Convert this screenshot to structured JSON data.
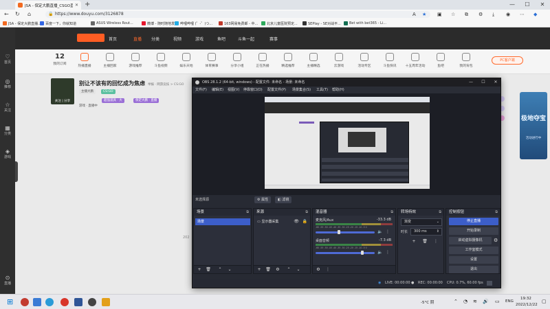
{
  "browser": {
    "tab_title": "JSA - 保定大鹏直播_CSGO直播",
    "new_tab": "+",
    "window_controls": [
      "—",
      "☐",
      "✕"
    ],
    "url": "https://www.douyu.com/3126878",
    "bookmarks": [
      "JSA - 保定大鹏直播...",
      "百度一下，你就知道",
      "ASUS Wireless Rout...",
      "微博 - 随时随地发...",
      "哔哩哔哩 (゜-゜)つ...",
      "163网易免费邮 - 中...",
      "北京儿童医院预定...",
      "SEPlay - SE对战平...",
      "Bet with bet365 - Li..."
    ]
  },
  "site": {
    "left_sidebar": [
      "首页",
      "推荐",
      "关注",
      "分类",
      "游戏",
      "直播"
    ],
    "top_nav": [
      "首页",
      "直播",
      "分类",
      "视频",
      "游戏",
      "鱼吧",
      "斗鱼一起",
      "赛事"
    ],
    "categories": [
      {
        "num": "12",
        "label": "我的订阅"
      },
      {
        "label": "热播直播"
      },
      {
        "label": "主播回家"
      },
      {
        "label": "游戏推荐"
      },
      {
        "label": "斗鱼视频"
      },
      {
        "label": "娱乐天地"
      },
      {
        "label": "体育赛事"
      },
      {
        "label": "分享小组"
      },
      {
        "label": "正在热播"
      },
      {
        "label": "精选推荐"
      },
      {
        "label": "主播精选"
      },
      {
        "label": "云游戏"
      },
      {
        "label": "活动专区"
      },
      {
        "label": "斗鱼快讯"
      },
      {
        "label": "十五周年活动"
      },
      {
        "label": "鱼吧"
      },
      {
        "label": "我的背包"
      },
      {
        "label": "充值中心"
      },
      {
        "label": "观看历史"
      },
      {
        "label": "更多"
      }
    ],
    "pc_client_button": "PC客户端",
    "room": {
      "title": "别让不该有的回忆成为焦虑",
      "sub": "举报 · 网游竞技 > CS:GO",
      "thumb_caption": "关注 | 分享",
      "tags": [
        "主播大鹏",
        "CS:GO",
        "超强道具 · 大",
        "保定大鹏 · 直播"
      ],
      "meta": "游戏 · 直播中"
    },
    "ad": {
      "title": "极地夺宝",
      "sub": "活动进行中"
    },
    "side_number": "202"
  },
  "obs": {
    "title": "OBS 28.1.2 (64-bit, windows) - 配置文件: 未命名 - 场景: 未命名",
    "menu": [
      "文件(F)",
      "编辑(E)",
      "视图(V)",
      "停靠窗口(D)",
      "配置文件(P)",
      "场景集合(S)",
      "工具(T)",
      "帮助(H)"
    ],
    "no_source_selected": "未选择源",
    "properties_button": "属性",
    "filters_button": "滤镜",
    "docks": {
      "scenes": {
        "title": "场景",
        "items": [
          "场景"
        ]
      },
      "sources": {
        "title": "来源",
        "items": [
          "显示器采集"
        ]
      },
      "mixer": {
        "title": "混音器",
        "channels": [
          {
            "name": "麦克风/Aux",
            "db": "-33.3 dB",
            "level": 0.38
          },
          {
            "name": "桌面音频",
            "db": "-7.3 dB",
            "level": 0.78
          }
        ],
        "scale": "-60 -55 -50 -45 -40 -35 -30 -25 -20 -15 -10 -5 0"
      },
      "transitions": {
        "title": "转场特效",
        "type": "渐变",
        "duration_label": "时长",
        "duration": "300 ms"
      },
      "controls": {
        "title": "控制按钮",
        "buttons": [
          "停止直播",
          "开始录制",
          "启动虚拟摄像机",
          "工作室模式",
          "设置",
          "退出"
        ]
      }
    },
    "status": {
      "live": "LIVE: 00:00:00",
      "rec": "REC: 00:00:00",
      "cpu": "CPU: 0.7%, 60.00 fps"
    }
  },
  "taskbar": {
    "weather": "-5°C 阴",
    "lang": "ENG",
    "time": "19:32",
    "date": "2022/12/22"
  }
}
